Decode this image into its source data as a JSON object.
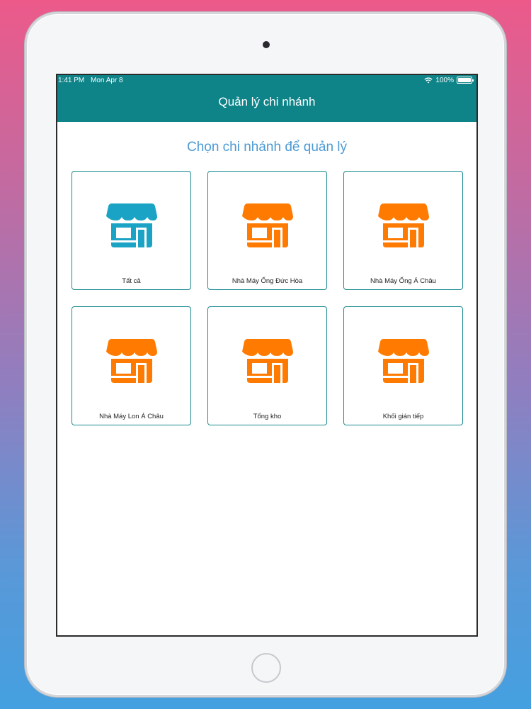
{
  "status_bar": {
    "time": "1:41 PM",
    "date": "Mon Apr 8",
    "battery": "100%"
  },
  "header": {
    "title": "Quản lý chi nhánh"
  },
  "subtitle": "Chọn chi nhánh để quản lý",
  "branches": [
    {
      "label": "Tất cả",
      "icon": "store-icon",
      "color": "#1aa3c4"
    },
    {
      "label": "Nhà Máy Ống Đức Hòa",
      "icon": "store-icon",
      "color": "#ff7a00"
    },
    {
      "label": "Nhà Máy Ống Á Châu",
      "icon": "store-icon",
      "color": "#ff7a00"
    },
    {
      "label": "Nhà Máy Lon Á Châu",
      "icon": "store-icon",
      "color": "#ff7a00"
    },
    {
      "label": "Tổng kho",
      "icon": "store-icon",
      "color": "#ff7a00"
    },
    {
      "label": "Khối gián tiếp",
      "icon": "store-icon",
      "color": "#ff7a00"
    }
  ],
  "colors": {
    "header": "#0e8489",
    "subtitle": "#4c9ad4",
    "card_border": "#1a8a8f"
  }
}
